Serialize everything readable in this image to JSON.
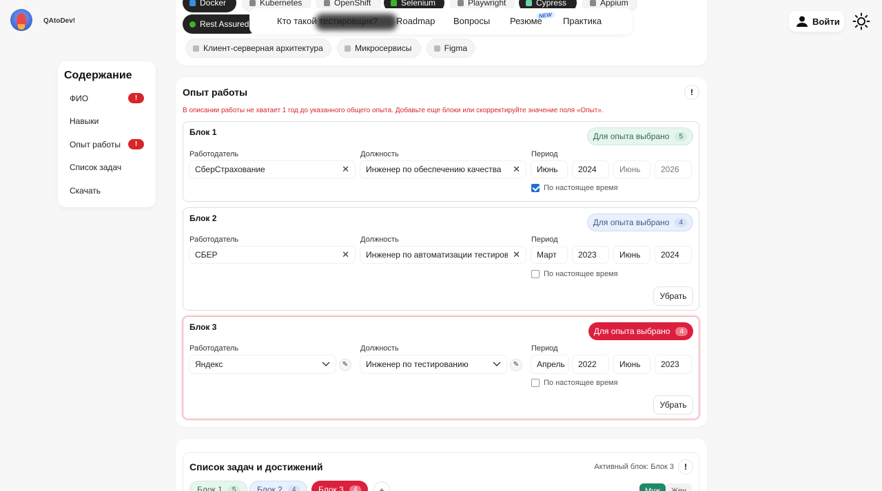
{
  "header": {
    "brand": "QAtoDev!",
    "nav": [
      "Кто такой тестировщик?",
      "Roadmap",
      "Вопросы",
      "Резюме",
      "Практика"
    ],
    "new_badge": "NEW",
    "login_label": "Войти"
  },
  "skills": {
    "row_top": [
      "Docker",
      "Kubernetes",
      "OpenShift",
      "Selenium",
      "Playwright",
      "Cypress",
      "Appium"
    ],
    "rest_assured": "Rest Assured",
    "row_bottom": [
      "Клиент-серверная архитектура",
      "Микросервисы",
      "Figma"
    ]
  },
  "sidebar": {
    "title": "Содержание",
    "items": [
      {
        "label": "ФИО",
        "badge": "!"
      },
      {
        "label": "Навыки",
        "badge": ""
      },
      {
        "label": "Опыт работы",
        "badge": "!"
      },
      {
        "label": "Список задач",
        "badge": ""
      },
      {
        "label": "Скачать",
        "badge": ""
      }
    ]
  },
  "experience": {
    "title": "Опыт работы",
    "info_button": "!",
    "warning": "В описании работы не хватает 1 год до указанного общего опыта. Добавьте еще блоки или скорректируйте значение поля «Опыт».",
    "labels": {
      "employer": "Работодатель",
      "position": "Должность",
      "period": "Период",
      "present": "По настоящее время",
      "remove": "Убрать",
      "selected": "Для опыта выбрано"
    },
    "blocks": [
      {
        "title": "Блок 1",
        "count": "5",
        "employer": "СберСтрахование",
        "position": "Инженер по обеспечению качества",
        "start_month": "Июнь",
        "start_year": "2024",
        "end_month": "Июнь",
        "end_year": "2026",
        "present": true
      },
      {
        "title": "Блок 2",
        "count": "4",
        "employer": "СБЕР",
        "position": "Инженер по автоматизации тестирования",
        "start_month": "Март",
        "start_year": "2023",
        "end_month": "Июнь",
        "end_year": "2024",
        "present": false
      },
      {
        "title": "Блок 3",
        "count": "4",
        "employer": "Яндекс",
        "position": "Инженер по тестированию",
        "start_month": "Апрель",
        "start_year": "2022",
        "end_month": "Июнь",
        "end_year": "2023",
        "present": false
      }
    ]
  },
  "tasks": {
    "title": "Список задач и достижений",
    "active_block": "Активный блок: Блок 3",
    "info_button": "!",
    "tabs": [
      {
        "label": "Блок 1",
        "count": "5"
      },
      {
        "label": "Блок 2",
        "count": "4"
      },
      {
        "label": "Блок 3",
        "count": "4"
      }
    ],
    "add_label": "+",
    "gender": [
      "Муж",
      "Жен"
    ]
  },
  "colors": {
    "accent_red": "#dc1f3d",
    "badge_red": "#d6262b",
    "green_pill": "#e7f5ef",
    "blue_pill": "#e8f0fb",
    "dark_chip": "#232323",
    "checkbox": "#1f6fd6"
  }
}
